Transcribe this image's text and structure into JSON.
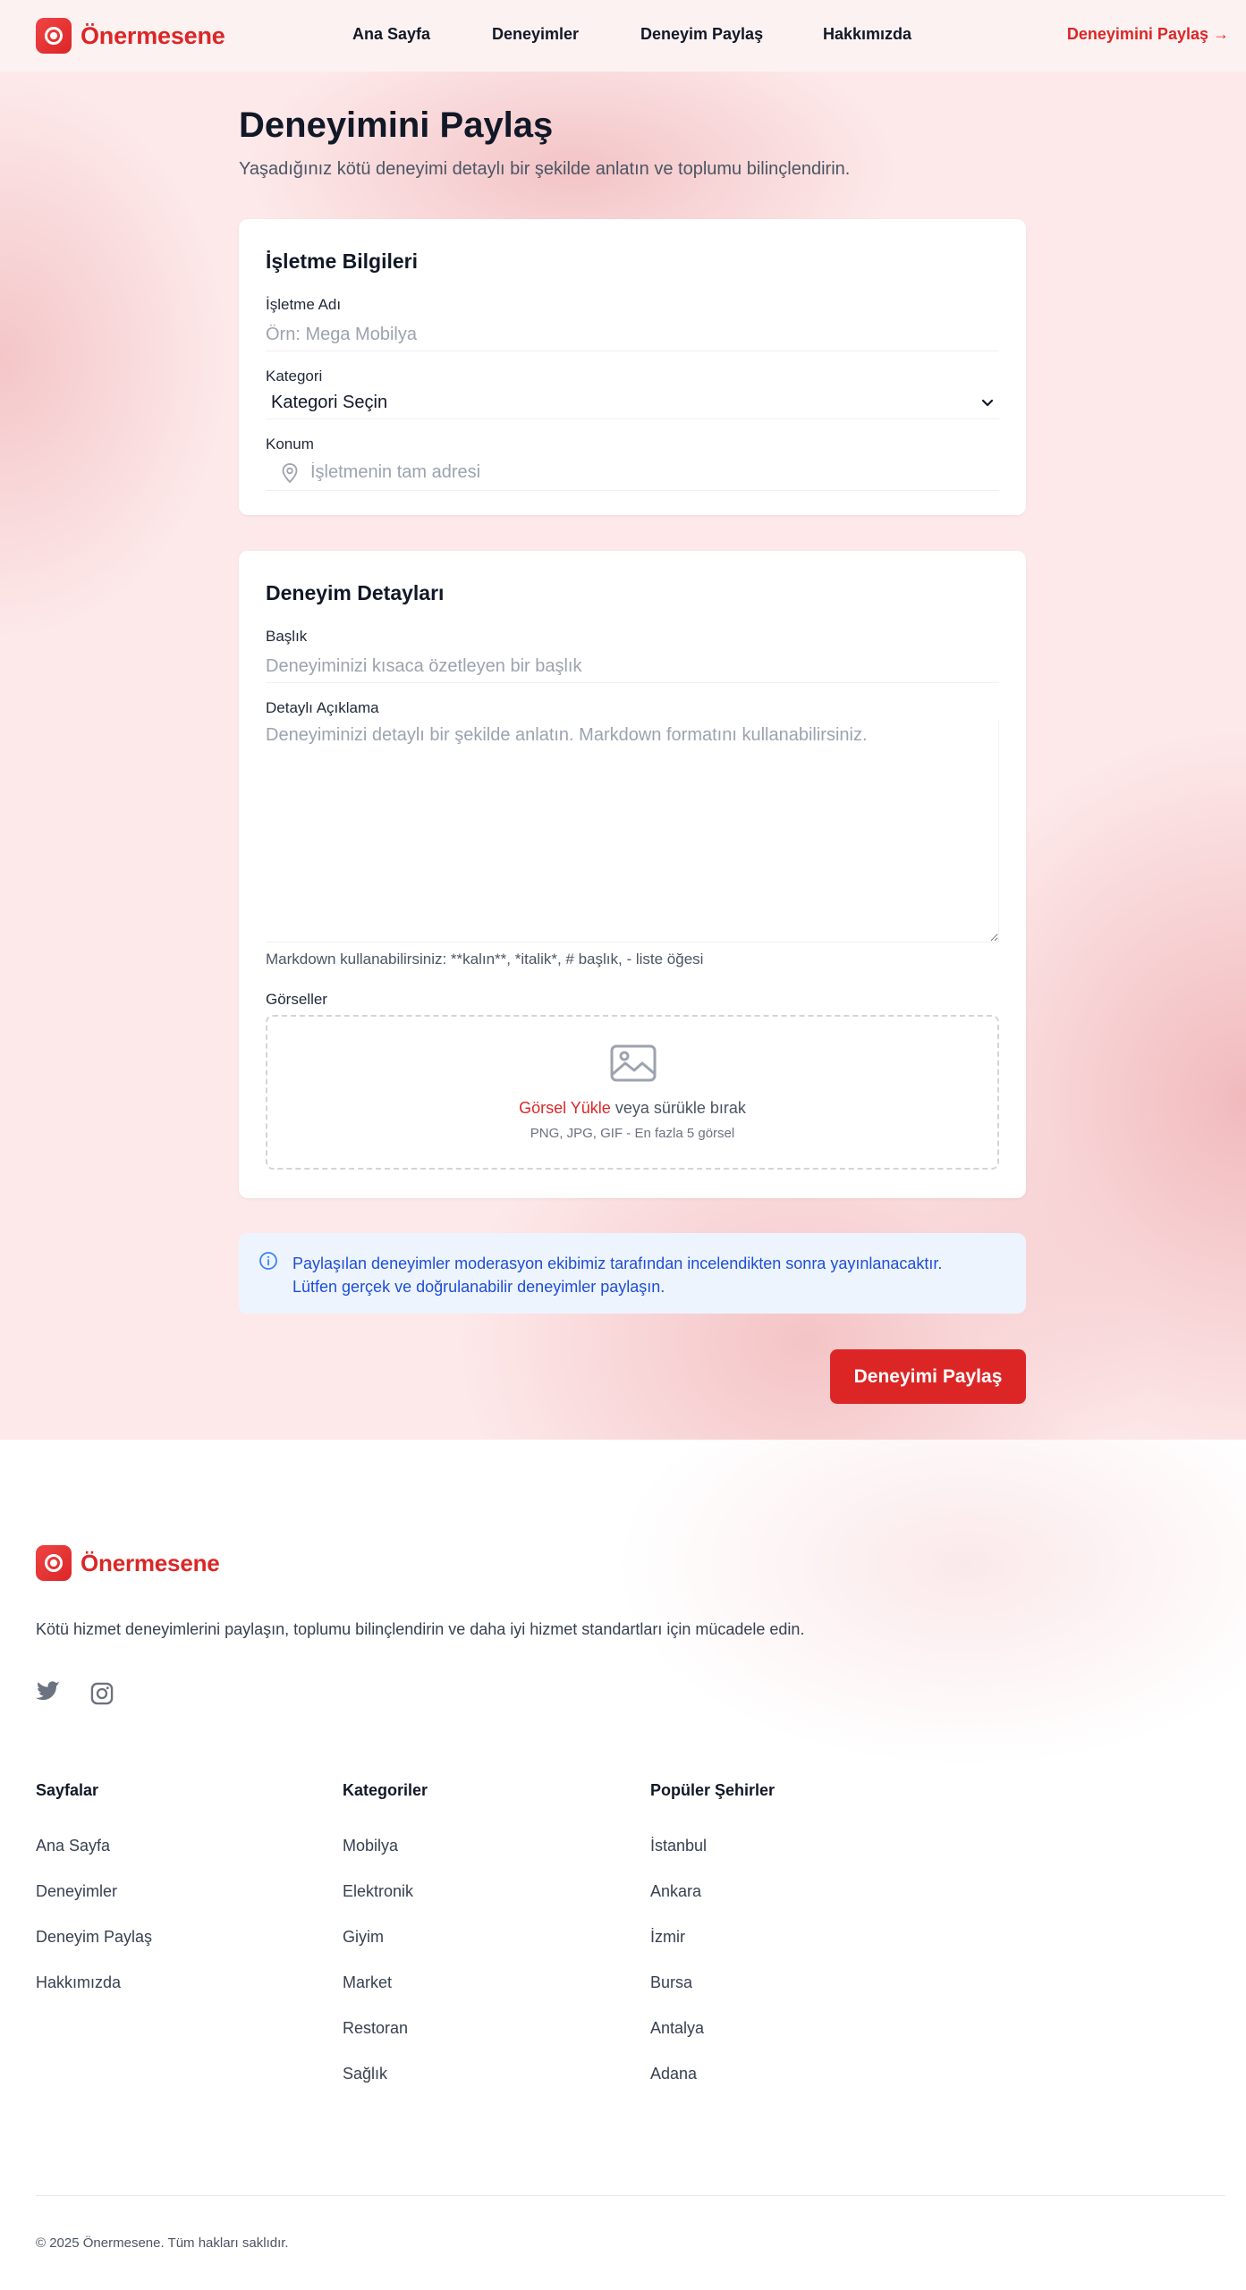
{
  "brand": {
    "name": "Önermesene",
    "accent": "#dc2626"
  },
  "nav": {
    "links": [
      "Ana Sayfa",
      "Deneyimler",
      "Deneyim Paylaş",
      "Hakkımızda"
    ],
    "cta": "Deneyimini Paylaş →"
  },
  "page": {
    "title": "Deneyimini Paylaş",
    "subtitle": "Yaşadığınız kötü deneyimi detaylı bir şekilde anlatın ve toplumu bilinçlendirin."
  },
  "business_card": {
    "title": "İşletme Bilgileri",
    "name_label": "İşletme Adı",
    "name_placeholder": "Örn: Mega Mobilya",
    "category_label": "Kategori",
    "category_selected": "Kategori Seçin",
    "location_label": "Konum",
    "location_placeholder": "İşletmenin tam adresi"
  },
  "experience_card": {
    "title": "Deneyim Detayları",
    "heading_label": "Başlık",
    "heading_placeholder": "Deneyiminizi kısaca özetleyen bir başlık",
    "description_label": "Detaylı Açıklama",
    "description_placeholder": "Deneyiminizi detaylı bir şekilde anlatın. Markdown formatını kullanabilirsiniz.",
    "markdown_hint": "Markdown kullanabilirsiniz: **kalın**, *italik*, # başlık, - liste öğesi",
    "images_label": "Görseller",
    "upload_link": "Görsel Yükle",
    "upload_rest": " veya sürükle bırak",
    "upload_sub": "PNG, JPG, GIF - En fazla 5 görsel"
  },
  "notice": {
    "line1": "Paylaşılan deneyimler moderasyon ekibimiz tarafından incelendikten sonra yayınlanacaktır.",
    "line2": "Lütfen gerçek ve doğrulanabilir deneyimler paylaşın.",
    "color": "#1d4ed8"
  },
  "submit_label": "Deneyimi Paylaş",
  "footer": {
    "description": "Kötü hizmet deneyimlerini paylaşın, toplumu bilinçlendirin ve daha iyi hizmet standartları için mücadele edin.",
    "social_icons": [
      "twitter-icon",
      "instagram-icon"
    ],
    "columns": [
      {
        "title": "Sayfalar",
        "links": [
          "Ana Sayfa",
          "Deneyimler",
          "Deneyim Paylaş",
          "Hakkımızda"
        ]
      },
      {
        "title": "Kategoriler",
        "links": [
          "Mobilya",
          "Elektronik",
          "Giyim",
          "Market",
          "Restoran",
          "Sağlık"
        ]
      },
      {
        "title": "Popüler Şehirler",
        "links": [
          "İstanbul",
          "Ankara",
          "İzmir",
          "Bursa",
          "Antalya",
          "Adana"
        ]
      }
    ],
    "copyright": "© 2025 Önermesene. Tüm hakları saklıdır."
  }
}
